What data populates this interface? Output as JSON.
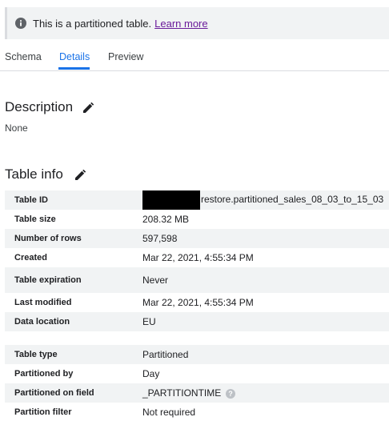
{
  "banner": {
    "icon": "info-icon",
    "text": "This is a partitioned table.",
    "link": "Learn more"
  },
  "tabs": [
    {
      "label": "Schema",
      "active": false
    },
    {
      "label": "Details",
      "active": true
    },
    {
      "label": "Preview",
      "active": false
    }
  ],
  "description": {
    "title": "Description",
    "value": "None"
  },
  "table_info": {
    "title": "Table info",
    "rows": [
      {
        "key": "Table ID",
        "value": "restore.partitioned_sales_08_03_to_15_03"
      },
      {
        "key": "Table size",
        "value": "208.32 MB"
      },
      {
        "key": "Number of rows",
        "value": "597,598"
      },
      {
        "key": "Created",
        "value": "Mar 22, 2021, 4:55:34 PM"
      },
      {
        "key": "Table expiration",
        "value": "Never"
      },
      {
        "key": "Last modified",
        "value": "Mar 22, 2021, 4:55:34 PM"
      },
      {
        "key": "Data location",
        "value": "EU"
      }
    ],
    "partition_rows": [
      {
        "key": "Table type",
        "value": "Partitioned"
      },
      {
        "key": "Partitioned by",
        "value": "Day"
      },
      {
        "key": "Partitioned on field",
        "value": "_PARTITIONTIME"
      },
      {
        "key": "Partition filter",
        "value": "Not required"
      }
    ]
  },
  "colors": {
    "accent": "#1a73e8",
    "link": "#6a1b9a",
    "row_shade": "#f1f3f4"
  }
}
